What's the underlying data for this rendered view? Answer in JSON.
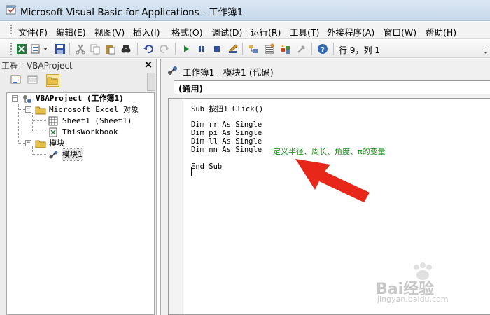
{
  "window": {
    "title": "Microsoft Visual Basic for Applications - 工作簿1"
  },
  "menu": {
    "items": [
      "文件(F)",
      "编辑(E)",
      "视图(V)",
      "插入(I)",
      "格式(O)",
      "调试(D)",
      "运行(R)",
      "工具(T)",
      "外接程序(A)",
      "窗口(W)",
      "帮助(H)"
    ]
  },
  "toolbar": {
    "cursor_position": "行 9，列 1"
  },
  "project_explorer": {
    "title": "工程 - VBAProject",
    "close_glyph": "×",
    "tree": {
      "root": "VBAProject (工作簿1)",
      "excel_objects": "Microsoft Excel 对象",
      "sheet1": "Sheet1 (Sheet1)",
      "thisworkbook": "ThisWorkbook",
      "modules": "模块",
      "module1": "模块1"
    }
  },
  "code_window": {
    "title": "工作簿1 - 模块1 (代码)",
    "object_combo": "(通用)",
    "lines": {
      "sub": "Sub 按扭1_Click()",
      "dim1": "Dim rr As Single",
      "dim2": "Dim pi As Single",
      "dim3": "Dim ll As Single",
      "dim4": "Dim nn As Single",
      "comment": "'定义半径、周长、角度、π的变量",
      "end": "End Sub"
    }
  },
  "watermark": {
    "brand": "Bai经验",
    "url": "jingyan.baidu.com"
  },
  "colors": {
    "comment": "#1a8a1a",
    "arrow": "#e8271b",
    "titlebar": "#c6d8ea"
  }
}
